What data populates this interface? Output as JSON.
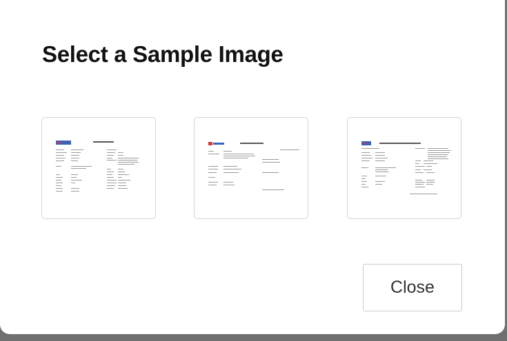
{
  "dialog": {
    "title": "Select a Sample Image",
    "close_label": "Close"
  },
  "samples": [
    {
      "name": "sample-image-1",
      "description": "scanned bank document preview"
    },
    {
      "name": "sample-image-2",
      "description": "scanned bank document preview"
    },
    {
      "name": "sample-image-3",
      "description": "scanned bank document preview"
    }
  ],
  "colors": {
    "overlay": "#6f6f6f",
    "dialog_background": "#ffffff",
    "title_text": "#111111",
    "thumbnail_border": "#d4d4d4",
    "logo_blue": "#3a62b8",
    "logo_red": "#d33a3a"
  }
}
